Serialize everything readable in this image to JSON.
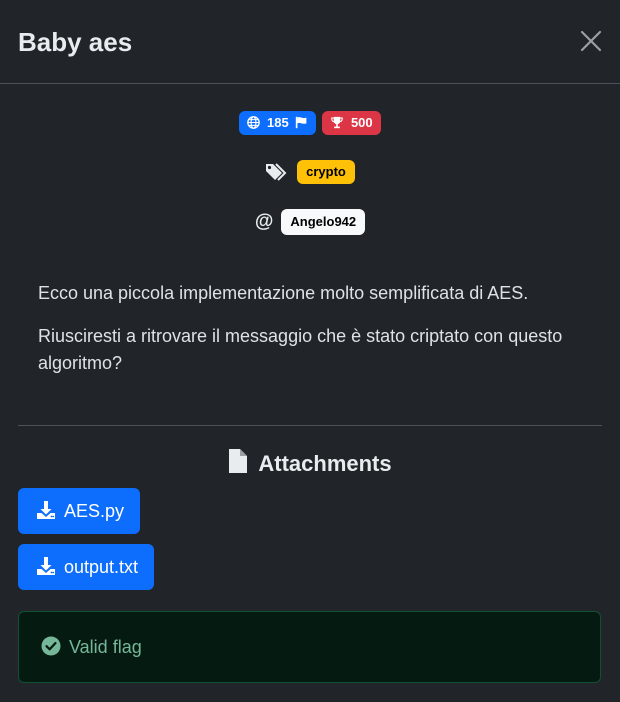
{
  "modal": {
    "title": "Baby aes",
    "close_icon": "close-icon"
  },
  "stats": {
    "solves": "185",
    "solves_icons": [
      "globe-icon",
      "flag-icon"
    ],
    "points": "500",
    "points_icon": "trophy-icon"
  },
  "tags": {
    "icon": "tags-icon",
    "items": [
      "crypto"
    ]
  },
  "author": {
    "icon_text": "@",
    "name": "Angelo942"
  },
  "description": {
    "paragraphs": [
      "Ecco una piccola implementazione molto semplificata di AES.",
      "Riusciresti a ritrovare il messaggio che è stato criptato con questo algoritmo?"
    ]
  },
  "attachments": {
    "heading": "Attachments",
    "heading_icon": "file-icon",
    "files": [
      "AES.py",
      "output.txt"
    ],
    "download_icon": "download-icon"
  },
  "status": {
    "message": "Valid flag",
    "icon": "check-circle-icon"
  },
  "colors": {
    "background": "#212529",
    "primary": "#0d6efd",
    "danger": "#dc3545",
    "warning": "#ffc107",
    "success_text": "#75b798",
    "success_bg": "#051b11"
  }
}
